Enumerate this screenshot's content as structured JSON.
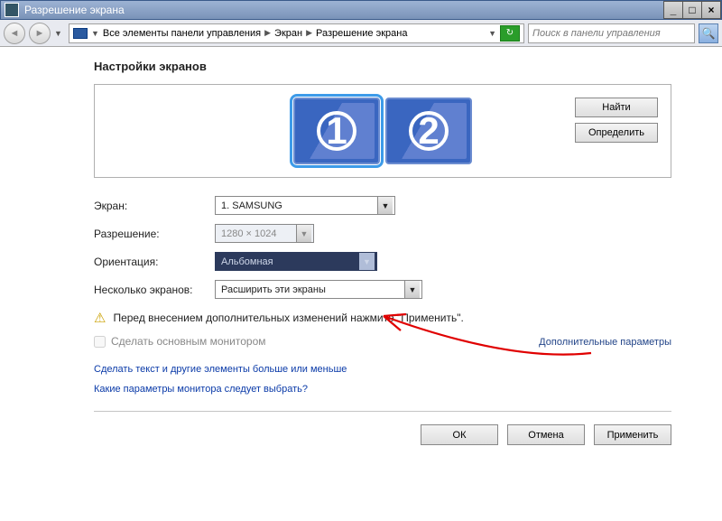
{
  "titlebar": {
    "title": "Разрешение экрана"
  },
  "breadcrumb": {
    "root": "Все элементы панели управления",
    "mid": "Экран",
    "leaf": "Разрешение экрана"
  },
  "search": {
    "placeholder": "Поиск в панели управления"
  },
  "heading": "Настройки экранов",
  "buttons": {
    "find": "Найти",
    "identify": "Определить",
    "ok": "ОК",
    "cancel": "Отмена",
    "apply": "Применить"
  },
  "monitors": [
    "1",
    "2"
  ],
  "fields": {
    "display_label": "Экран:",
    "display_value": "1. SAMSUNG",
    "resolution_label": "Разрешение:",
    "resolution_value": "1280 × 1024",
    "orientation_label": "Ориентация:",
    "orientation_value": "Альбомная",
    "multi_label": "Несколько экранов:",
    "multi_value": "Расширить эти экраны"
  },
  "warning": "Перед внесением дополнительных изменений нажмите \"Применить\".",
  "checkbox": "Сделать основным монитором",
  "advanced": "Дополнительные параметры",
  "links": {
    "text_size": "Сделать текст и другие элементы больше или меньше",
    "which_monitor": "Какие параметры монитора следует выбрать?"
  }
}
